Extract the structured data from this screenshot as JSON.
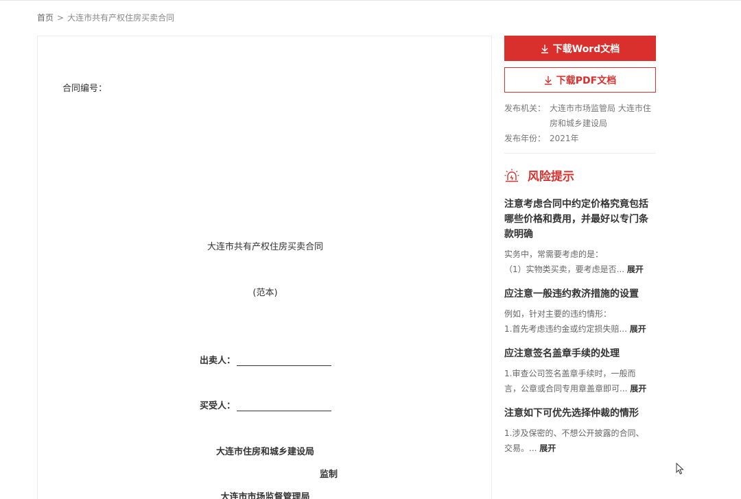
{
  "breadcrumb": {
    "home": "首页",
    "separator": ">",
    "current": "大连市共有产权住房买卖合同"
  },
  "document": {
    "contract_no_label": "合同编号：",
    "title": "大连市共有产权住房买卖合同",
    "subtitle": "(范本)",
    "seller_label": "出卖人：",
    "buyer_label": "买受人：",
    "issuer1": "大连市住房和城乡建设局",
    "supervise": "监制",
    "issuer2": "大连市市场监督管理局"
  },
  "sidebar": {
    "download_word": "下载Word文档",
    "download_pdf": "下载PDF文档",
    "publisher_label": "发布机关：",
    "publisher_value": "大连市市场监管局 大连市住房和城乡建设局",
    "year_label": "发布年份：",
    "year_value": "2021年",
    "risk_title": "风险提示",
    "expand_label": "展开",
    "tips": [
      {
        "title": "注意考虑合同中约定价格究竟包括哪些价格和费用，并最好以专门条款明确",
        "line1": "实务中，常需要考虑的是：",
        "line2": "（1）实物类买卖，要考虑是否..."
      },
      {
        "title": "应注意一般违约救济措施的设置",
        "line1": "例如，针对主要的违约情形：",
        "line2": "1.首先考虑违约金或约定损失赔..."
      },
      {
        "title": "应注意签名盖章手续的处理",
        "line1": "1.审查公司签名盖章手续时，一般而",
        "line2": "言，公章或合同专用章盖章即可..."
      },
      {
        "title": "注意如下可优先选择仲裁的情形",
        "line1": "1.涉及保密的、不想公开披露的合同、",
        "line2": "交易。..."
      }
    ]
  },
  "colors": {
    "accent": "#d9302d",
    "text": "#333333",
    "muted": "#666666"
  },
  "icons": {
    "download": "download-icon",
    "risk": "alarm-light-icon",
    "cursor": "mouse-cursor-icon"
  }
}
